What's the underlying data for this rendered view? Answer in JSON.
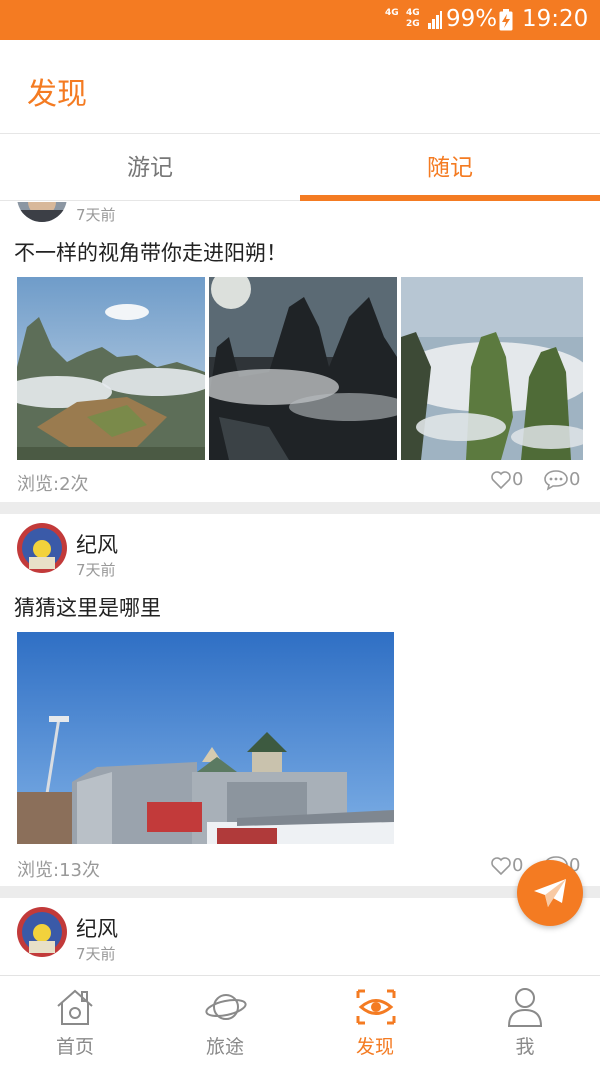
{
  "status_bar": {
    "network_1": "4G",
    "network_2": "4G",
    "network_2b": "2G",
    "battery_percent": "99%",
    "time": "19:20",
    "color": "#f47b22"
  },
  "header": {
    "title": "发现"
  },
  "tabs": [
    {
      "label": "游记",
      "active": false
    },
    {
      "label": "随记",
      "active": true
    }
  ],
  "posts": [
    {
      "author": "",
      "time": "7天前",
      "text": "不一样的视角带你走进阳朔！",
      "images": [
        "karst-valley-photo",
        "karst-silhouette-photo",
        "karst-peaks-photo"
      ],
      "views": "浏览:2次",
      "likes": "0",
      "comments": "0"
    },
    {
      "author": "纪风",
      "time": "7天前",
      "text": "猜猜这里是哪里",
      "images": [
        "station-building-photo"
      ],
      "views": "浏览:13次",
      "likes": "0",
      "comments": "0"
    },
    {
      "author": "纪风",
      "time": "7天前"
    }
  ],
  "fab": {
    "icon": "paper-plane-icon"
  },
  "bottom_nav": [
    {
      "label": "首页",
      "icon": "home-icon",
      "active": false
    },
    {
      "label": "旅途",
      "icon": "planet-icon",
      "active": false
    },
    {
      "label": "发现",
      "icon": "eye-icon",
      "active": true
    },
    {
      "label": "我",
      "icon": "person-icon",
      "active": false
    }
  ],
  "accent_color": "#f47b22"
}
